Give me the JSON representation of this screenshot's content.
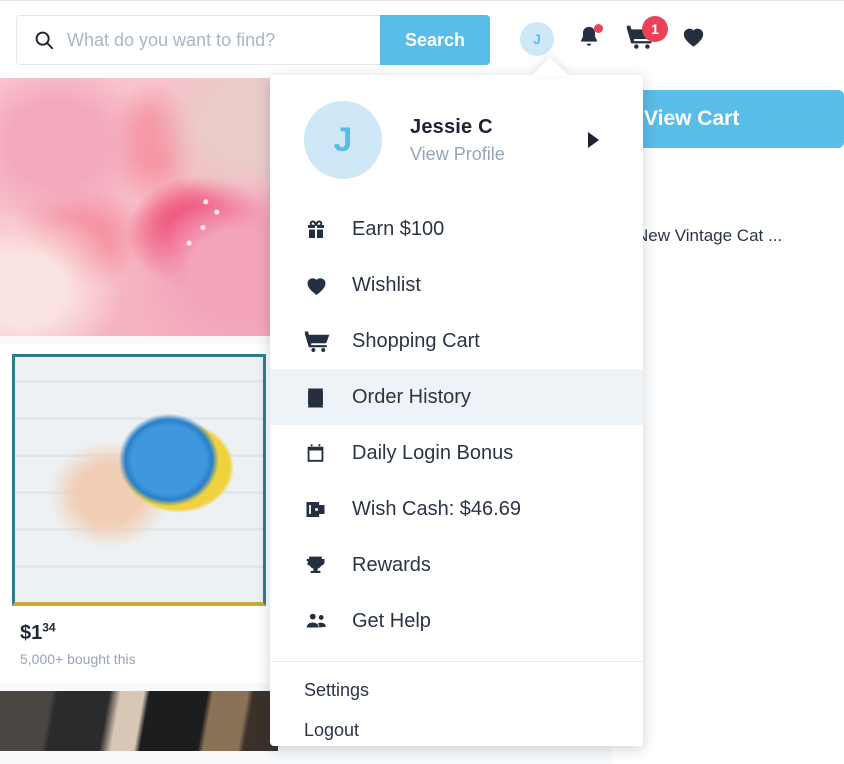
{
  "header": {
    "search": {
      "placeholder": "What do you want to find?",
      "value": "",
      "icon": "search-icon"
    },
    "search_button": "Search",
    "avatar_initial": "J",
    "notification_icon": "bell-icon",
    "cart_icon": "cart-icon",
    "cart_badge": "1",
    "wishlist_icon": "heart-icon"
  },
  "dropdown": {
    "avatar_initial": "J",
    "user_name": "Jessie C",
    "view_profile": "View Profile",
    "chevron_icon": "chevron-right-icon",
    "items": [
      {
        "label": "Earn $100",
        "icon": "gift-icon",
        "active": false
      },
      {
        "label": "Wishlist",
        "icon": "heart-icon",
        "active": false
      },
      {
        "label": "Shopping Cart",
        "icon": "cart-icon",
        "active": false
      },
      {
        "label": "Order History",
        "icon": "receipt-icon",
        "active": true
      },
      {
        "label": "Daily Login Bonus",
        "icon": "calendar-icon",
        "active": false
      },
      {
        "label": "Wish Cash: $46.69",
        "icon": "wallet-icon",
        "active": false
      },
      {
        "label": "Rewards",
        "icon": "trophy-icon",
        "active": false
      },
      {
        "label": "Get Help",
        "icon": "people-icon",
        "active": false
      }
    ],
    "footer_items": [
      {
        "label": "Settings"
      },
      {
        "label": "Logout"
      }
    ]
  },
  "background": {
    "view_cart_button": "View Cart",
    "recommendation_text": "New Vintage Cat ...",
    "product": {
      "price_dollars": "$1",
      "price_cents": "34",
      "bought_text": "5,000+ bought this"
    }
  },
  "colors": {
    "accent_blue": "#5abce8",
    "badge_red": "#ea4258",
    "avatar_bg": "#cfe8f7",
    "text_dark": "#2b3445",
    "text_muted": "#97a4b4",
    "hover_bg": "#eef3f7"
  }
}
